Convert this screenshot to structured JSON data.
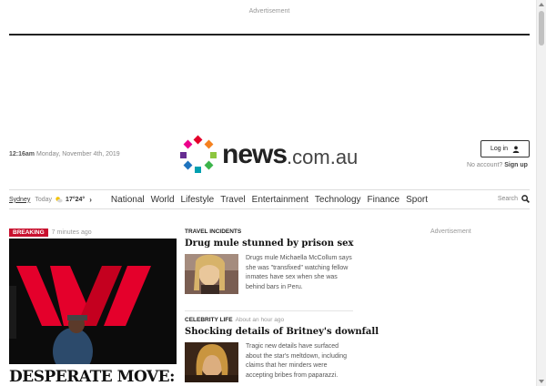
{
  "ad_top": {
    "label": "Advertisement"
  },
  "header": {
    "time": "12:16am",
    "date": "Monday, November 4th, 2019",
    "logo": {
      "word": "news",
      "suffix": ".com.au"
    },
    "login_label": "Log in",
    "no_account": "No account?",
    "signup": "Sign up"
  },
  "nav": {
    "weather": {
      "city": "Sydney",
      "day": "Today",
      "low": "17°",
      "high": "24°",
      "icon": "partly-sunny-icon"
    },
    "links": [
      "National",
      "World",
      "Lifestyle",
      "Travel",
      "Entertainment",
      "Technology",
      "Finance",
      "Sport"
    ],
    "search_label": "Search"
  },
  "hero": {
    "badge": "Breaking",
    "time_ago": "7 minutes ago",
    "title": "DESPERATE MOVE:"
  },
  "stories": [
    {
      "category": "Travel Incidents",
      "time_ago": "",
      "title": "Drug mule stunned by prison sex",
      "summary": "Drugs mule Michaella McCollum says she was \"transfixed\" watching fellow inmates have sex when she was behind bars in Peru."
    },
    {
      "category": "Celebrity Life",
      "time_ago": "About an hour ago",
      "title": "Shocking details of Britney's downfall",
      "summary": "Tragic new details have surfaced about the star's meltdown, including claims that her minders were accepting bribes from paparazzi."
    }
  ],
  "ad_side": {
    "label": "Advertisement"
  },
  "colors": {
    "breaking": "#c8102e",
    "westpac_red": "#e4002b"
  }
}
